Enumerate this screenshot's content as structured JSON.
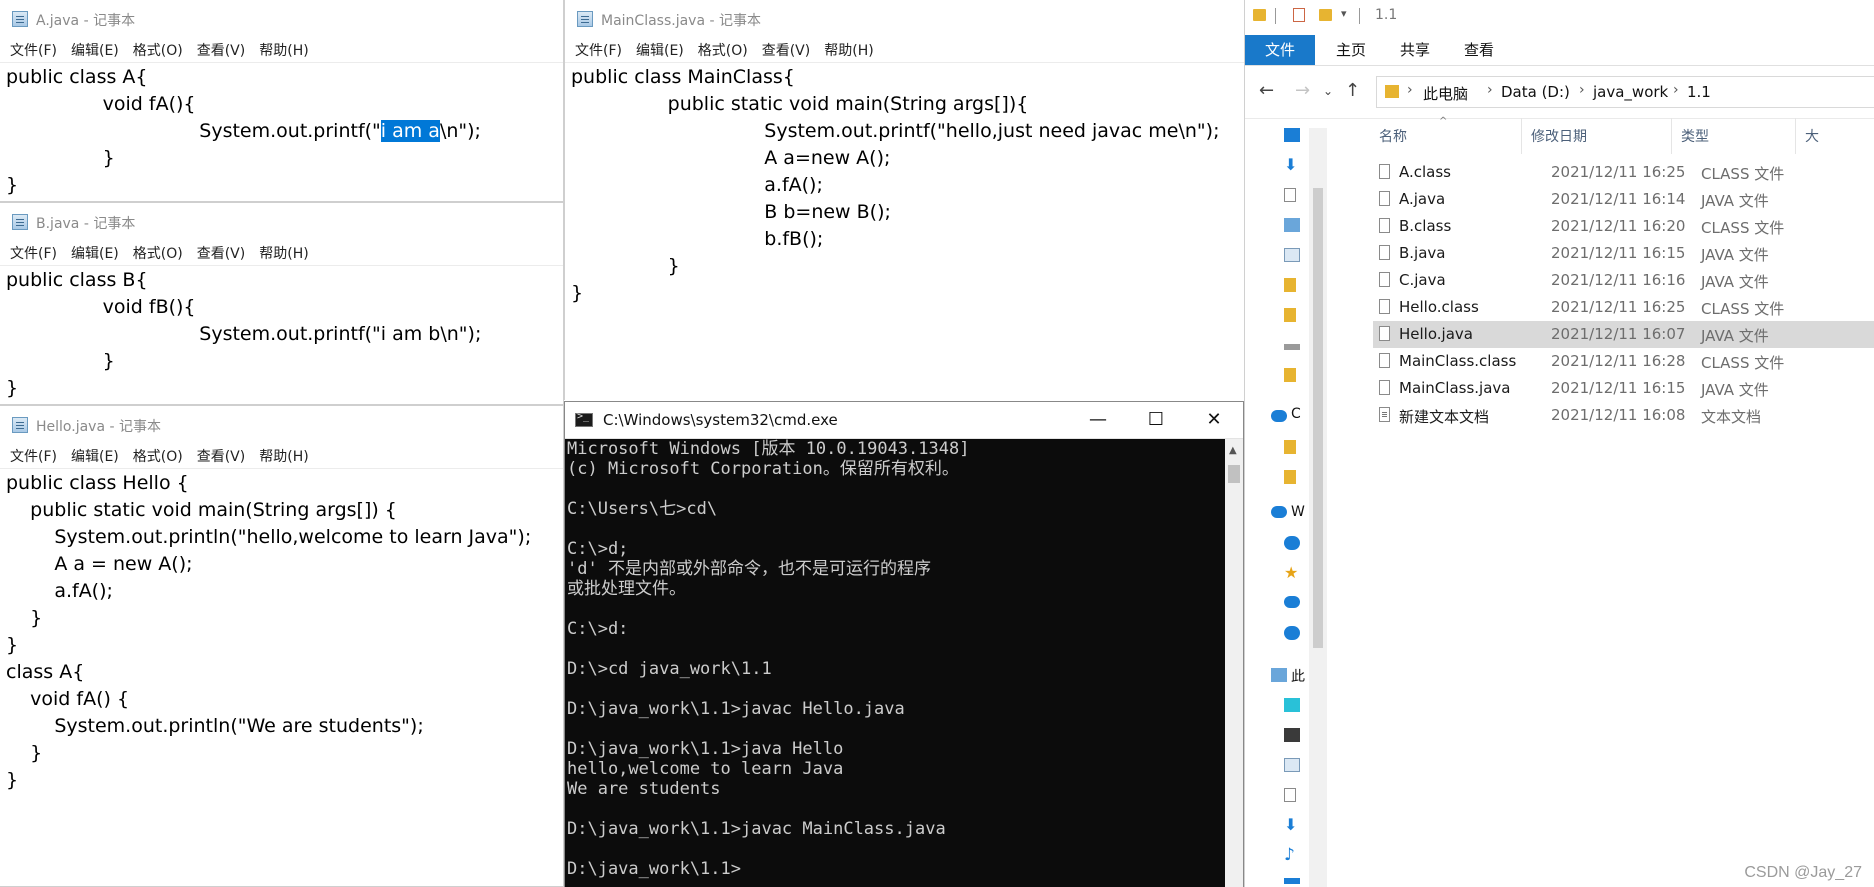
{
  "notepad_menu": [
    "文件(F)",
    "编辑(E)",
    "格式(O)",
    "查看(V)",
    "帮助(H)"
  ],
  "a_java": {
    "title": "A.java - 记事本",
    "code": [
      "public class A{",
      "                void fA(){",
      "                                System.out.printf(\"",
      "                }",
      "}"
    ],
    "line3_selected": "i am a",
    "line3_rest": "\\n\");"
  },
  "b_java": {
    "title": "B.java - 记事本",
    "code": [
      "public class B{",
      "                void fB(){",
      "                                System.out.printf(\"i am b\\n\");",
      "                }",
      "}"
    ]
  },
  "hello_java": {
    "title": "Hello.java - 记事本",
    "code": [
      "public class Hello {",
      "    public static void main(String args[]) {",
      "        System.out.println(\"hello,welcome to learn Java\");",
      "        A a = new A();",
      "        a.fA();",
      "    }",
      "}",
      "class A{",
      "    void fA() {",
      "        System.out.println(\"We are students\");",
      "    }",
      "}"
    ]
  },
  "mainclass_java": {
    "title": "MainClass.java - 记事本",
    "code": [
      "public class MainClass{",
      "                public static void main(String args[]){",
      "                                System.out.printf(\"hello,just need javac me\\n\");",
      "                                A a=new A();",
      "                                a.fA();",
      "                                B b=new B();",
      "                                b.fB();",
      "                }",
      "}"
    ]
  },
  "cmd": {
    "title": "C:\\Windows\\system32\\cmd.exe",
    "minimize": "—",
    "maximize": "☐",
    "close": "✕",
    "lines": [
      "Microsoft Windows [版本 10.0.19043.1348]",
      "(c) Microsoft Corporation。保留所有权利。",
      "",
      "C:\\Users\\七>cd\\",
      "",
      "C:\\>d;",
      "'d' 不是内部或外部命令，也不是可运行的程序",
      "或批处理文件。",
      "",
      "C:\\>d:",
      "",
      "D:\\>cd java_work\\1.1",
      "",
      "D:\\java_work\\1.1>javac Hello.java",
      "",
      "D:\\java_work\\1.1>java Hello",
      "hello,welcome to learn Java",
      "We are students",
      "",
      "D:\\java_work\\1.1>javac MainClass.java",
      "",
      "D:\\java_work\\1.1>"
    ]
  },
  "explorer": {
    "qat_title": "1.1",
    "tabs": [
      "文件",
      "主页",
      "共享",
      "查看"
    ],
    "breadcrumb": [
      "此电脑",
      "Data (D:)",
      "java_work",
      "1.1"
    ],
    "columns": {
      "name": "名称",
      "date": "修改日期",
      "type": "类型",
      "size": "大"
    },
    "side_labels": [
      "C",
      "W",
      "此"
    ],
    "files": [
      {
        "name": "A.class",
        "date": "2021/12/11 16:25",
        "type": "CLASS 文件"
      },
      {
        "name": "A.java",
        "date": "2021/12/11 16:14",
        "type": "JAVA 文件"
      },
      {
        "name": "B.class",
        "date": "2021/12/11 16:20",
        "type": "CLASS 文件"
      },
      {
        "name": "B.java",
        "date": "2021/12/11 16:15",
        "type": "JAVA 文件"
      },
      {
        "name": "C.java",
        "date": "2021/12/11 16:16",
        "type": "JAVA 文件"
      },
      {
        "name": "Hello.class",
        "date": "2021/12/11 16:25",
        "type": "CLASS 文件"
      },
      {
        "name": "Hello.java",
        "date": "2021/12/11 16:07",
        "type": "JAVA 文件"
      },
      {
        "name": "MainClass.class",
        "date": "2021/12/11 16:28",
        "type": "CLASS 文件"
      },
      {
        "name": "MainClass.java",
        "date": "2021/12/11 16:15",
        "type": "JAVA 文件"
      },
      {
        "name": "新建文本文档",
        "date": "2021/12/11 16:08",
        "type": "文本文档"
      }
    ],
    "selected_file": "Hello.java"
  },
  "watermark": "CSDN @Jay_27"
}
